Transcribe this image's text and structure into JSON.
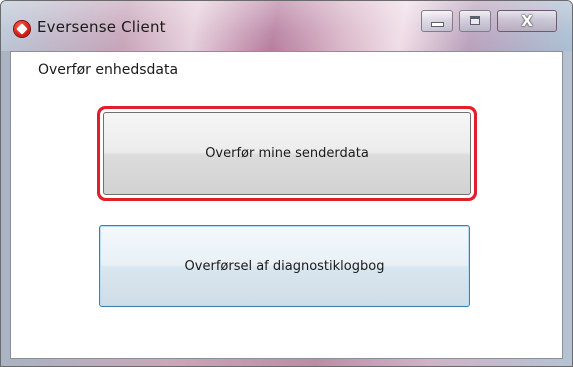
{
  "window": {
    "title": "Eversense Client",
    "controls": {
      "minimize": "minimize",
      "maximize": "maximize",
      "close": "X"
    }
  },
  "main": {
    "section_label": "Overfør enhedsdata",
    "buttons": {
      "transfer_sensor_data": "Overfør mine senderdata",
      "transfer_diagnostic_log": "Overførsel af diagnostiklogbog"
    }
  },
  "colors": {
    "highlight": "#e01f2a",
    "focus_border": "#3c7fb1",
    "app_icon": "#d8231a"
  },
  "icons": {
    "app": "eversense-logo-icon",
    "minimize": "minimize-icon",
    "maximize": "maximize-icon",
    "close": "close-icon"
  }
}
